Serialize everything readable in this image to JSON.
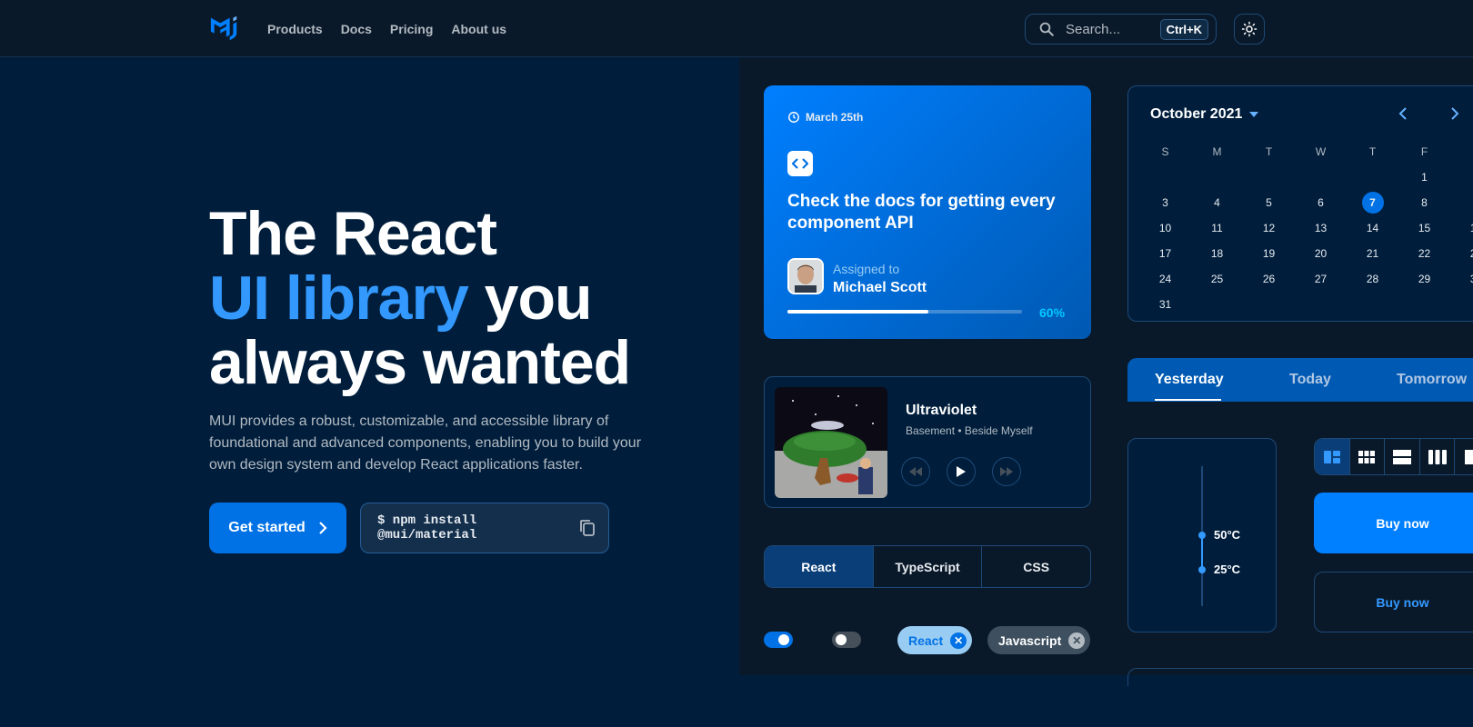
{
  "nav": {
    "links": [
      "Products",
      "Docs",
      "Pricing",
      "About us"
    ],
    "search_placeholder": "Search...",
    "search_shortcut": "Ctrl+K",
    "theme_icon": "sun-icon"
  },
  "hero": {
    "title_line1": "The React",
    "title_accent": "UI library",
    "title_line2_rest": " you",
    "title_line3": "always wanted",
    "description": "MUI provides a robust, customizable, and accessible library of foundational and advanced components, enabling you to build your own design system and develop React applications faster.",
    "cta_label": "Get started",
    "install_command": "$ npm install @mui/material"
  },
  "task_card": {
    "date": "March 25th",
    "title": "Check the docs for getting every component API",
    "assigned_label": "Assigned to",
    "assignee": "Michael Scott",
    "progress": 0.6,
    "progress_label": "60%"
  },
  "player": {
    "song": "Ultraviolet",
    "artist": "Basement • Beside Myself"
  },
  "segmented_tabs": {
    "items": [
      "React",
      "TypeScript",
      "CSS"
    ],
    "selected": "React"
  },
  "switches": [
    true,
    false
  ],
  "chips": [
    "React",
    "Javascript"
  ],
  "calendar": {
    "month_label": "October 2021",
    "weekdays": [
      "S",
      "M",
      "T",
      "W",
      "T",
      "F",
      "S"
    ],
    "first_weekday_index": 5,
    "days_in_month": 31,
    "selected_day": 7
  },
  "day_tabs": {
    "items": [
      "Yesterday",
      "Today",
      "Tomorrow"
    ],
    "selected": "Yesterday"
  },
  "temperature_slider": {
    "high_label": "50°C",
    "low_label": "25°C"
  },
  "view_toggle": {
    "icons": [
      "dashboard-icon",
      "grid-view-icon",
      "split-view-icon",
      "columns-view-icon",
      "panel-view-icon"
    ],
    "selected": "dashboard-icon"
  },
  "buy_buttons": {
    "primary_label": "Buy now",
    "secondary_label": "Buy now"
  },
  "colors": {
    "background": "#001e3c",
    "nav_background": "#0a1929",
    "accent": "#007fff",
    "accent_text": "#3399ff",
    "border": "#1e4976"
  }
}
